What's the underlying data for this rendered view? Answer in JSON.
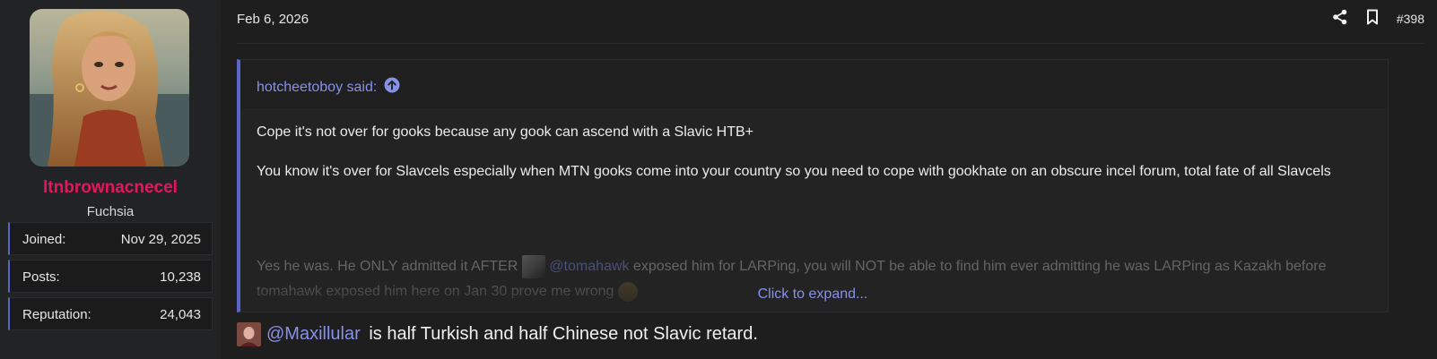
{
  "post": {
    "date": "Feb 6, 2026",
    "number": "#398"
  },
  "author": {
    "username": "ltnbrownacnecel",
    "title": "Fuchsia",
    "stats": [
      {
        "label": "Joined:",
        "value": "Nov 29, 2025"
      },
      {
        "label": "Posts:",
        "value": "10,238"
      },
      {
        "label": "Reputation:",
        "value": "24,043"
      }
    ]
  },
  "quote": {
    "author_label": "hotcheetoboy said:",
    "paragraphs": [
      "Cope it's not over for gooks because any gook can ascend with a Slavic HTB+",
      "You know it's over for Slavcels especially when MTN gooks come into your country so you need to cope with gookhate on an obscure incel forum, total fate of all Slavcels"
    ],
    "faded_part1": "Yes he was. He ONLY admitted it AFTER ",
    "faded_mention": "@tomahawk",
    "faded_part2": " exposed him for LARPing, you will NOT be able to find him ever admitting he was LARPing as Kazakh before tomahawk exposed him here on Jan 30 prove me wrong ",
    "expand_label": "Click to expand..."
  },
  "reply": {
    "mention": "@Maxillular",
    "text": " is half Turkish and half Chinese not Slavic retard."
  },
  "colors": {
    "accent": "#5965c7",
    "link": "#8691e8",
    "username": "#e8155b",
    "background": "#1e1e1f"
  },
  "icons": [
    "share-icon",
    "bookmark-icon",
    "arrow-up-circle-icon"
  ]
}
